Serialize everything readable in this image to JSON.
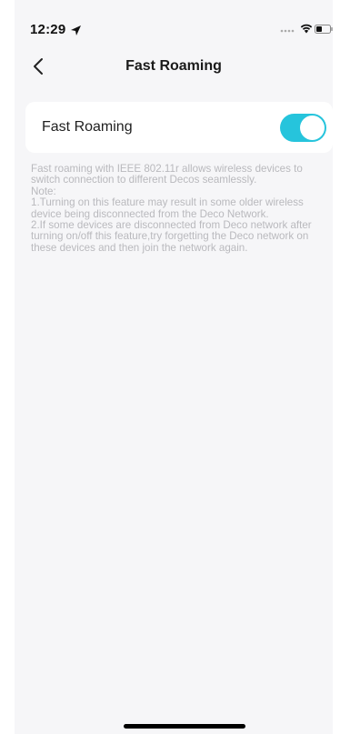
{
  "status_bar": {
    "time": "12:29"
  },
  "nav": {
    "title": "Fast Roaming"
  },
  "setting": {
    "label": "Fast Roaming",
    "enabled": true
  },
  "description": {
    "intro": "Fast roaming with IEEE 802.11r allows wireless devices to switch connection to different Decos seamlessly.",
    "note_label": "Note:",
    "note_1": "1.Turning on this feature may result in some older wireless device being disconnected from the Deco Network.",
    "note_2": "2.If some devices are disconnected from Deco network after turning on/off this feature,try forgetting the Deco network on these devices and then join the network again."
  },
  "colors": {
    "accent": "#26c4dc",
    "background": "#f6f6f8",
    "description_text": "#b9b9bd"
  },
  "icons": {
    "back": "chevron-left-icon",
    "location": "location-arrow-icon",
    "signal": "signal-icon",
    "wifi": "wifi-icon",
    "battery": "battery-icon"
  }
}
